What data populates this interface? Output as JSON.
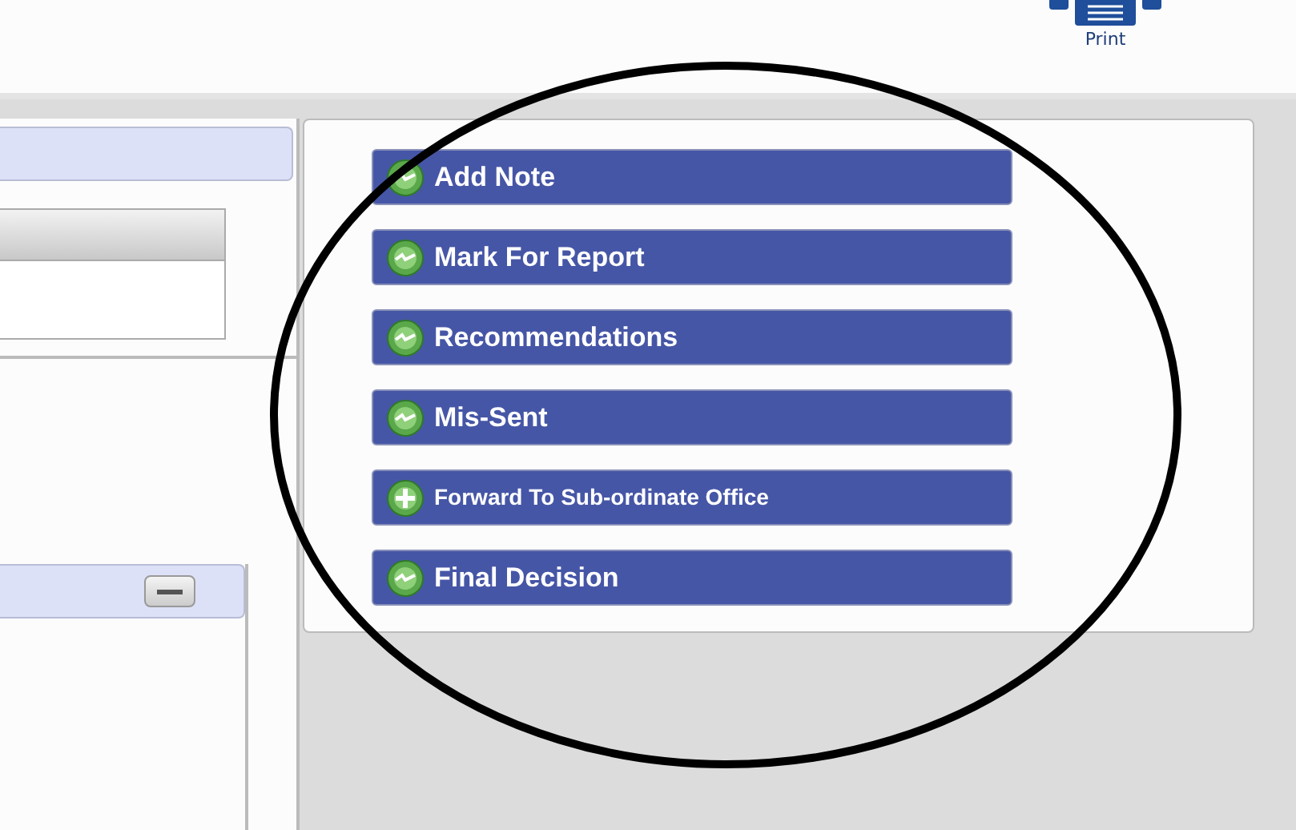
{
  "toolbar": {
    "print_label": "Print"
  },
  "actions": [
    {
      "label": "Add Note",
      "kind": "arrow"
    },
    {
      "label": "Mark For Report",
      "kind": "arrow"
    },
    {
      "label": "Recommendations",
      "kind": "arrow"
    },
    {
      "label": "Mis-Sent",
      "kind": "arrow"
    },
    {
      "label": "Forward To Sub-ordinate Office",
      "kind": "plus"
    },
    {
      "label": "Final Decision",
      "kind": "arrow"
    }
  ],
  "annotation": {
    "kind": "circle"
  }
}
